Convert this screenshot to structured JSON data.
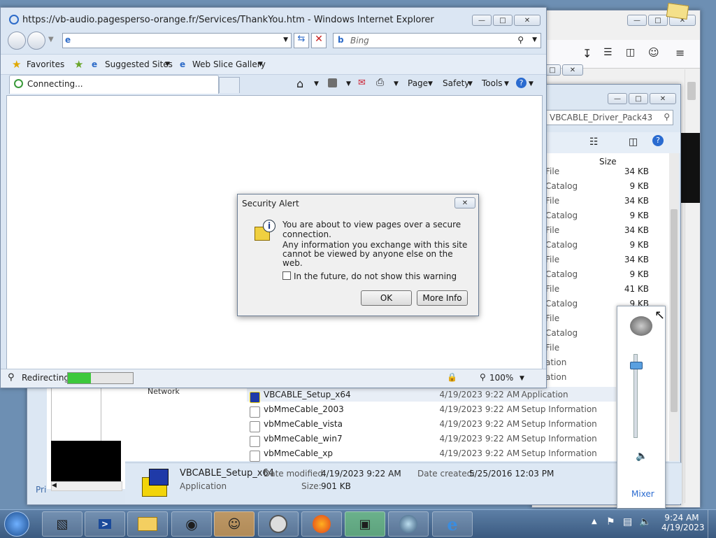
{
  "ie": {
    "title": "https://vb-audio.pagesperso-orange.fr/Services/ThankYou.htm - Windows Internet Explorer",
    "address_value": "",
    "search_placeholder": "Bing",
    "favorites_label": "Favorites",
    "suggested_sites_label": "Suggested Sites",
    "web_slice_label": "Web Slice Gallery",
    "tab_label": "Connecting...",
    "cmd": {
      "page": "Page",
      "safety": "Safety",
      "tools": "Tools"
    },
    "status_text": "Redirecting",
    "status_progress": 0.35,
    "zoom": "100%"
  },
  "dialog": {
    "title": "Security Alert",
    "line1": "You are about to view pages over a secure connection.",
    "line2": "Any information you exchange with this site cannot be viewed by anyone else on the web.",
    "checkbox_label": "In the future, do not show this warning",
    "checkbox_checked": false,
    "ok_label": "OK",
    "more_info_label": "More Info"
  },
  "explorer": {
    "search_value": "VBCABLE_Driver_Pack43",
    "col_size": "Size",
    "partial_rows": [
      {
        "type": "File",
        "size": "34 KB"
      },
      {
        "type": "Catalog",
        "size": "9 KB"
      },
      {
        "type": "File",
        "size": "34 KB"
      },
      {
        "type": "Catalog",
        "size": "9 KB"
      },
      {
        "type": "File",
        "size": "34 KB"
      },
      {
        "type": "Catalog",
        "size": "9 KB"
      },
      {
        "type": "File",
        "size": "34 KB"
      },
      {
        "type": "Catalog",
        "size": "9 KB"
      },
      {
        "type": "File",
        "size": "41 KB"
      },
      {
        "type": "Catalog",
        "size": "9 KB"
      },
      {
        "type": "File",
        "size": ""
      },
      {
        "type": "Catalog",
        "size": ""
      },
      {
        "type": "File",
        "size": ""
      },
      {
        "type": "ation",
        "size": ""
      },
      {
        "type": "ation",
        "size": ""
      }
    ],
    "rows": [
      {
        "name": "VBCABLE_Setup_x64",
        "date": "4/19/2023 9:22 AM",
        "type": "Application"
      },
      {
        "name": "vbMmeCable_2003",
        "date": "4/19/2023 9:22 AM",
        "type": "Setup Information"
      },
      {
        "name": "vbMmeCable_vista",
        "date": "4/19/2023 9:22 AM",
        "type": "Setup Information"
      },
      {
        "name": "vbMmeCable_win7",
        "date": "4/19/2023 9:22 AM",
        "type": "Setup Information"
      },
      {
        "name": "vbMmeCable_xp",
        "date": "4/19/2023 9:22 AM",
        "type": "Setup Information"
      }
    ],
    "details": {
      "name": "VBCABLE_Setup_x64",
      "kind": "Application",
      "modified_label": "Date modified:",
      "modified": "4/19/2023 9:22 AM",
      "created_label": "Date created:",
      "created": "5/25/2016 12:03 PM",
      "size_label": "Size:",
      "size": "901 KB"
    },
    "nav_partial": "Network",
    "left_partial": "Pri"
  },
  "mixer": {
    "label": "Mixer",
    "level": 0.9
  },
  "tray": {
    "time": "9:24 AM",
    "date": "4/19/2023"
  },
  "colors": {
    "accent": "#1a5fb4",
    "progress": "#3cc83c",
    "taskbar": "#3f6189"
  }
}
